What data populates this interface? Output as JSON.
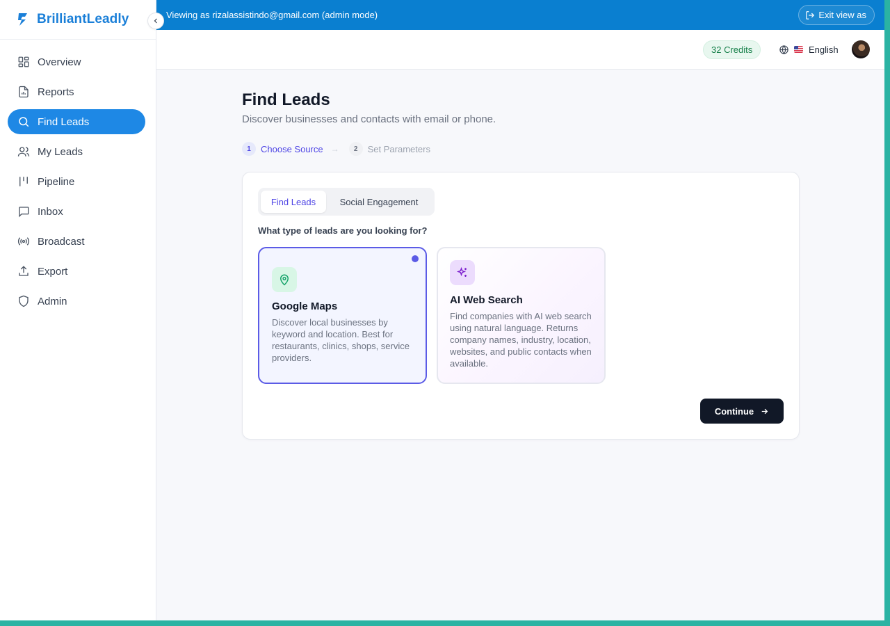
{
  "brand": {
    "name": "BrilliantLeadly"
  },
  "banner": {
    "text": "Viewing as rizalassistindo@gmail.com (admin mode)",
    "exit_label": "Exit view as"
  },
  "header": {
    "credits": "32 Credits",
    "language": "English"
  },
  "sidebar": {
    "items": [
      {
        "label": "Overview",
        "icon": "grid-icon"
      },
      {
        "label": "Reports",
        "icon": "report-icon"
      },
      {
        "label": "Find Leads",
        "icon": "search-icon",
        "active": true
      },
      {
        "label": "My Leads",
        "icon": "users-icon"
      },
      {
        "label": "Pipeline",
        "icon": "pipeline-icon"
      },
      {
        "label": "Inbox",
        "icon": "message-icon"
      },
      {
        "label": "Broadcast",
        "icon": "broadcast-icon"
      },
      {
        "label": "Export",
        "icon": "upload-icon"
      },
      {
        "label": "Admin",
        "icon": "shield-icon"
      }
    ]
  },
  "page": {
    "title": "Find Leads",
    "subtitle": "Discover businesses and contacts with email or phone.",
    "steps": [
      {
        "number": "1",
        "label": "Choose Source",
        "active": true
      },
      {
        "number": "2",
        "label": "Set Parameters",
        "active": false
      }
    ],
    "arrow": "→"
  },
  "card": {
    "tabs": [
      {
        "label": "Find Leads",
        "active": true
      },
      {
        "label": "Social Engagement",
        "active": false
      }
    ],
    "question": "What type of leads are you looking for?",
    "options": [
      {
        "title": "Google Maps",
        "description": "Discover local businesses by keyword and location. Best for restaurants, clinics, shops, service providers.",
        "icon": "map-pin-icon",
        "selected": true
      },
      {
        "title": "AI Web Search",
        "description": "Find companies with AI web search using natural language. Returns company names, industry, location, websites, and public contacts when available.",
        "icon": "sparkles-icon",
        "selected": false
      }
    ],
    "continue_label": "Continue"
  },
  "colors": {
    "brand": "#1a7fd8",
    "banner": "#0a7fd0",
    "active_nav": "#1e88e5",
    "accent": "#5b5be6",
    "primary_button": "#111827",
    "credits_text": "#17804a"
  }
}
